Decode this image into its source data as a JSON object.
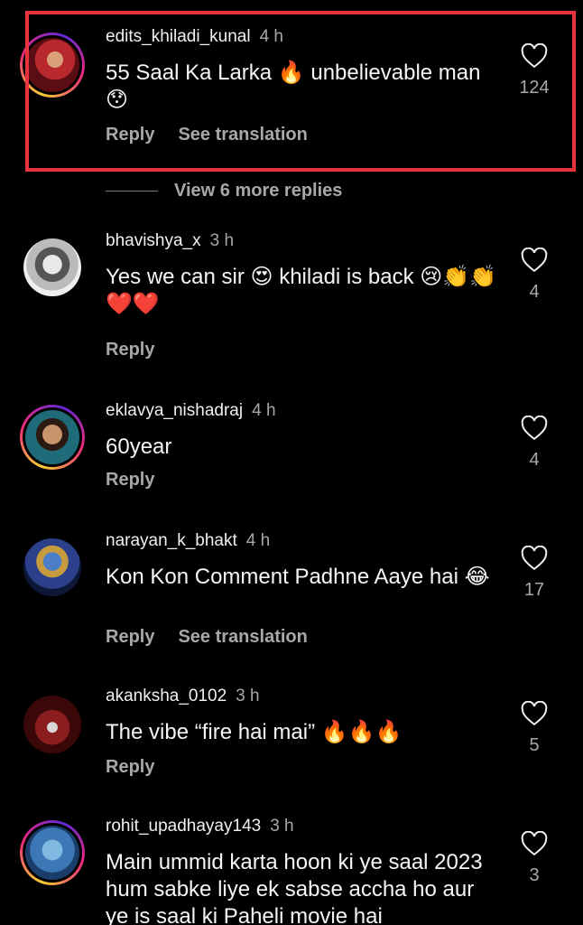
{
  "comments": [
    {
      "username": "edits_khiladi_kunal",
      "time": "4 h",
      "text": "55 Saal Ka Larka 🔥 unbelievable man 😯",
      "likes": "124",
      "reply": "Reply",
      "translation": "See translation"
    },
    {
      "username": "bhavishya_x",
      "time": "3 h",
      "text": "Yes we can sir 😍 khiladi is back 😢👏👏❤️❤️",
      "likes": "4",
      "reply": "Reply"
    },
    {
      "username": "eklavya_nishadraj",
      "time": "4 h",
      "text": "60year",
      "likes": "4",
      "reply": "Reply"
    },
    {
      "username": "narayan_k_bhakt",
      "time": "4 h",
      "text": "Kon Kon Comment Padhne Aaye hai 😂",
      "likes": "17",
      "reply": "Reply",
      "translation": "See translation"
    },
    {
      "username": "akanksha_0102",
      "time": "3 h",
      "text": "The vibe “fire hai mai” 🔥🔥🔥",
      "likes": "5",
      "reply": "Reply"
    },
    {
      "username": "rohit_upadhayay143",
      "time": "3 h",
      "text": "Main ummid karta hoon ki ye saal 2023 hum sabke liye ek sabse accha ho aur ye is saal ki Paheli movie hai",
      "likes": "3"
    }
  ],
  "view_more_replies": "View 6 more replies",
  "colors": {
    "highlight": "#e8323f",
    "background": "#000000",
    "muted": "#a8a8a8"
  }
}
